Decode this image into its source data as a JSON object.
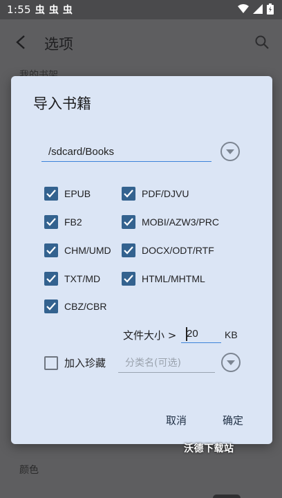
{
  "status_bar": {
    "time": "1:55",
    "notification_glyphs": [
      "虫",
      "虫",
      "虫"
    ]
  },
  "background": {
    "title": "选项",
    "partial_section": "我的书架",
    "color_label": "颜色"
  },
  "dialog": {
    "title": "导入书籍",
    "path_value": "/sdcard/Books",
    "formats": [
      {
        "label": "EPUB",
        "checked": true
      },
      {
        "label": "PDF/DJVU",
        "checked": true
      },
      {
        "label": "FB2",
        "checked": true
      },
      {
        "label": "MOBI/AZW3/PRC",
        "checked": true
      },
      {
        "label": "CHM/UMD",
        "checked": true
      },
      {
        "label": "DOCX/ODT/RTF",
        "checked": true
      },
      {
        "label": "TXT/MD",
        "checked": true
      },
      {
        "label": "HTML/MHTML",
        "checked": true
      },
      {
        "label": "CBZ/CBR",
        "checked": true
      }
    ],
    "file_size_label": "文件大小 >",
    "file_size_value": "20",
    "file_size_unit": "KB",
    "favorite_label": "加入珍藏",
    "favorite_checked": false,
    "category_placeholder": "分类名(可选)",
    "cancel_label": "取消",
    "ok_label": "确定"
  },
  "watermark": "沃德下载站",
  "colors": {
    "checkbox_checked": "#33628f",
    "dialog_bg": "#dbe5f5",
    "accent_underline": "#3b82d9"
  }
}
